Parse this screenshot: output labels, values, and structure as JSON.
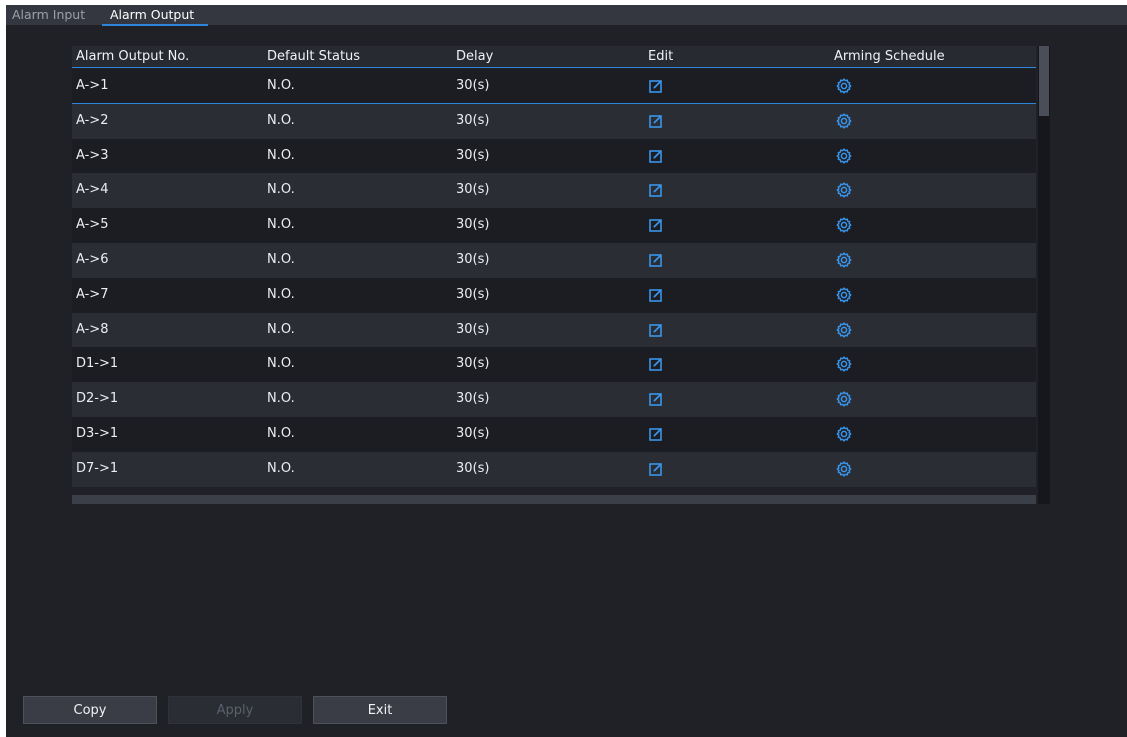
{
  "tabs": [
    {
      "label": "Alarm Input",
      "active": false
    },
    {
      "label": "Alarm Output",
      "active": true
    }
  ],
  "table": {
    "columns": [
      "Alarm Output No.",
      "Default Status",
      "Delay",
      "Edit",
      "Arming Schedule"
    ],
    "rows": [
      {
        "no": "A->1",
        "status": "N.O.",
        "delay": "30(s)"
      },
      {
        "no": "A->2",
        "status": "N.O.",
        "delay": "30(s)"
      },
      {
        "no": "A->3",
        "status": "N.O.",
        "delay": "30(s)"
      },
      {
        "no": "A->4",
        "status": "N.O.",
        "delay": "30(s)"
      },
      {
        "no": "A->5",
        "status": "N.O.",
        "delay": "30(s)"
      },
      {
        "no": "A->6",
        "status": "N.O.",
        "delay": "30(s)"
      },
      {
        "no": "A->7",
        "status": "N.O.",
        "delay": "30(s)"
      },
      {
        "no": "A->8",
        "status": "N.O.",
        "delay": "30(s)"
      },
      {
        "no": "D1->1",
        "status": "N.O.",
        "delay": "30(s)"
      },
      {
        "no": "D2->1",
        "status": "N.O.",
        "delay": "30(s)"
      },
      {
        "no": "D3->1",
        "status": "N.O.",
        "delay": "30(s)"
      },
      {
        "no": "D7->1",
        "status": "N.O.",
        "delay": "30(s)"
      }
    ],
    "selected_row": 0,
    "edit_icon": "edit-icon",
    "schedule_icon": "gear-icon"
  },
  "buttons": {
    "copy": "Copy",
    "apply": "Apply",
    "exit": "Exit"
  },
  "colors": {
    "accent": "#2d86dc",
    "background": "#1f2127",
    "row_alt": "#2a2d34",
    "row": "#1b1d23"
  }
}
